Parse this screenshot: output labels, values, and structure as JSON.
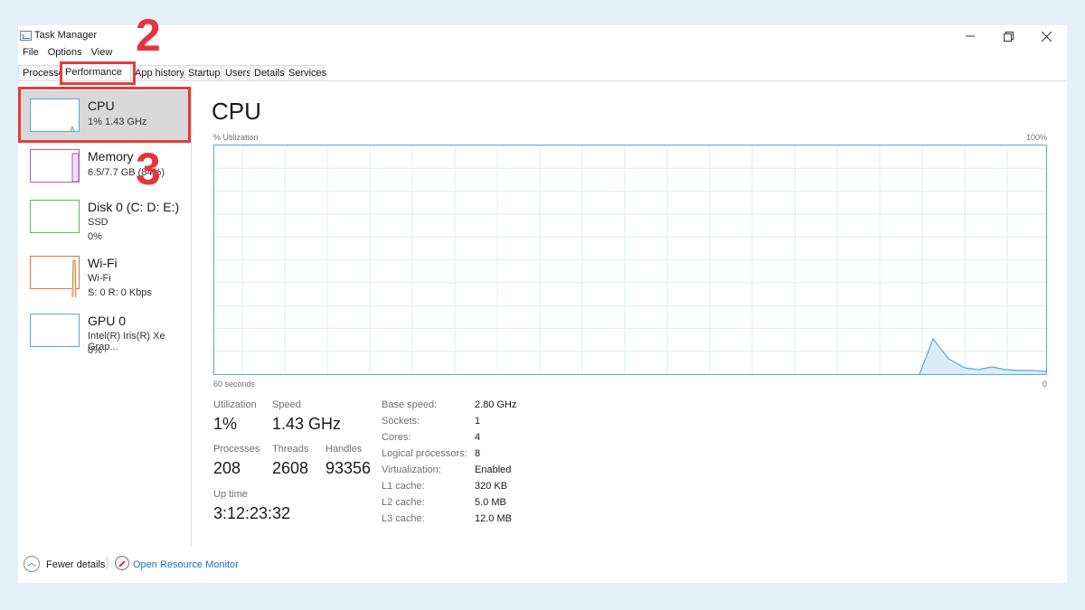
{
  "window": {
    "title": "Task Manager"
  },
  "menu": [
    "File",
    "Options",
    "View"
  ],
  "tabs": [
    "Processes",
    "Performance",
    "App history",
    "Startup",
    "Users",
    "Details",
    "Services"
  ],
  "annotations": [
    "2",
    "3"
  ],
  "sidebar": {
    "items": [
      {
        "name": "CPU",
        "sub1": "1%  1.43 GHz",
        "sub2": "",
        "color": "#5aa7dc"
      },
      {
        "name": "Memory",
        "sub1": "6.5/7.7 GB (84%)",
        "sub2": "",
        "color": "#b05ac8"
      },
      {
        "name": "Disk 0 (C: D: E:)",
        "sub1": "SSD",
        "sub2": "0%",
        "color": "#62b84a"
      },
      {
        "name": "Wi-Fi",
        "sub1": "Wi-Fi",
        "sub2": "S: 0  R: 0 Kbps",
        "color": "#d27a3a"
      },
      {
        "name": "GPU 0",
        "sub1": "Intel(R) Iris(R) Xe Grap...",
        "sub2": "0%",
        "color": "#5aa7dc"
      }
    ]
  },
  "main": {
    "title": "CPU",
    "util_label": "% Utilization",
    "max_label": "100%",
    "time_label": "60 seconds",
    "zero_label": "0",
    "graph_color": "#5aa7dc",
    "stats": {
      "utilization": {
        "label": "Utilization",
        "value": "1%"
      },
      "speed": {
        "label": "Speed",
        "value": "1.43 GHz"
      },
      "processes": {
        "label": "Processes",
        "value": "208"
      },
      "threads": {
        "label": "Threads",
        "value": "2608"
      },
      "handles": {
        "label": "Handles",
        "value": "93356"
      },
      "uptime": {
        "label": "Up time",
        "value": "3:12:23:32"
      }
    },
    "specs": [
      {
        "label": "Base speed:",
        "value": "2.80 GHz"
      },
      {
        "label": "Sockets:",
        "value": "1"
      },
      {
        "label": "Cores:",
        "value": "4"
      },
      {
        "label": "Logical processors:",
        "value": "8"
      },
      {
        "label": "Virtualization:",
        "value": "Enabled"
      },
      {
        "label": "L1 cache:",
        "value": "320 KB"
      },
      {
        "label": "L2 cache:",
        "value": "5.0 MB"
      },
      {
        "label": "L3 cache:",
        "value": "12.0 MB"
      }
    ]
  },
  "footer": {
    "fewer": "Fewer details",
    "monitor": "Open Resource Monitor"
  }
}
